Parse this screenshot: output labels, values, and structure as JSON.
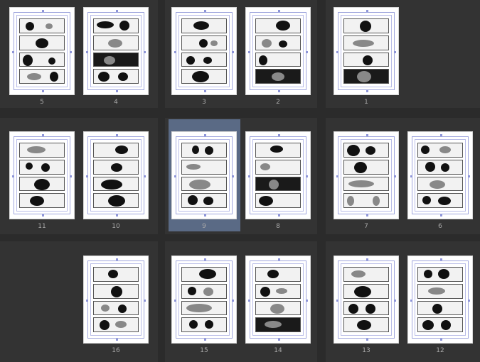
{
  "pages": [
    {
      "num": "5"
    },
    {
      "num": "4"
    },
    {
      "num": "3"
    },
    {
      "num": "2"
    },
    {
      "num": "1"
    },
    {
      "num": "11"
    },
    {
      "num": "10"
    },
    {
      "num": "9"
    },
    {
      "num": "8"
    },
    {
      "num": "7"
    },
    {
      "num": "6"
    },
    {
      "num": "16"
    },
    {
      "num": "15"
    },
    {
      "num": "14"
    },
    {
      "num": "13"
    },
    {
      "num": "12"
    }
  ],
  "selected_page": "9"
}
